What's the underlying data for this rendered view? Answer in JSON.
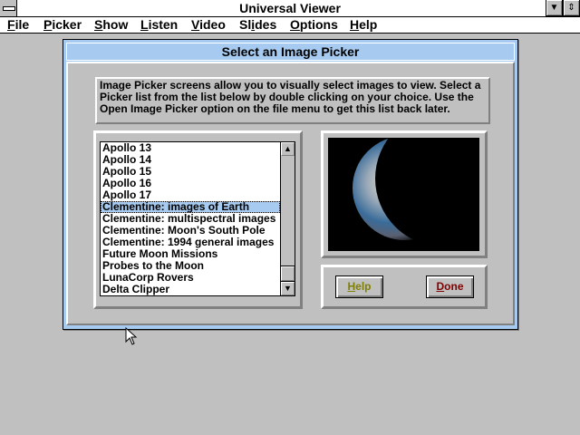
{
  "window": {
    "title": "Universal Viewer"
  },
  "menubar": [
    {
      "label": "File",
      "key": "F",
      "rest": "ile"
    },
    {
      "label": "Picker",
      "key": "P",
      "rest": "icker"
    },
    {
      "label": "Show",
      "key": "S",
      "rest": "how"
    },
    {
      "label": "Listen",
      "key": "L",
      "rest": "isten"
    },
    {
      "label": "Video",
      "key": "V",
      "rest": "ideo"
    },
    {
      "label": "Slides",
      "pre": "Sl",
      "key": "i",
      "rest": "des"
    },
    {
      "label": "Options",
      "key": "O",
      "rest": "ptions"
    },
    {
      "label": "Help",
      "key": "H",
      "rest": "elp"
    }
  ],
  "dialog": {
    "title": "Select an Image Picker",
    "instructions": "Image Picker screens allow you  to visually select images to view. Select a Picker list from the list below by double clicking on your choice. Use the Open Image Picker option on the file menu to get this list back later.",
    "list": [
      "Apollo 13",
      "Apollo 14",
      "Apollo 15",
      "Apollo 16",
      "Apollo 17",
      "Clementine: images of Earth",
      "Clementine: multispectral images",
      "Clementine: Moon's South Pole",
      "Clementine: 1994 general images",
      "Future Moon Missions",
      "Probes to the Moon",
      "LunaCorp Rovers",
      "Delta Clipper"
    ],
    "selected": "Clementine: images of Earth",
    "help": {
      "key": "H",
      "rest": "elp",
      "color": "#808000"
    },
    "done": {
      "key": "D",
      "rest": "one",
      "color": "#800000"
    }
  }
}
